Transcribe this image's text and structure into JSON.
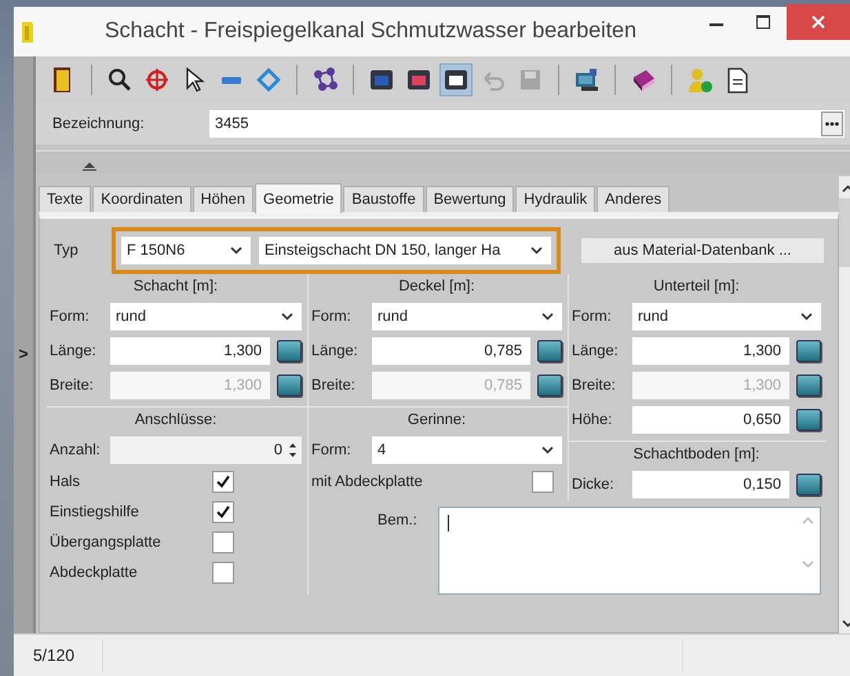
{
  "window": {
    "title": "Schacht - Freispiegelkanal Schmutzwasser bearbeiten"
  },
  "toolbar": {
    "groups": [
      [
        {
          "kind": "door",
          "selected": false,
          "disabled": false
        }
      ],
      [
        {
          "kind": "search",
          "selected": false,
          "disabled": false
        },
        {
          "kind": "crosshair",
          "selected": false,
          "disabled": false
        },
        {
          "kind": "pointer",
          "selected": false,
          "disabled": false
        },
        {
          "kind": "minus",
          "selected": false,
          "disabled": false
        },
        {
          "kind": "diamond",
          "selected": false,
          "disabled": false
        }
      ],
      [
        {
          "kind": "network",
          "selected": false,
          "disabled": false
        }
      ],
      [
        {
          "kind": "window-blue",
          "selected": false,
          "disabled": false
        },
        {
          "kind": "window-red",
          "selected": false,
          "disabled": false
        },
        {
          "kind": "window-white",
          "selected": true,
          "disabled": false
        },
        {
          "kind": "undo",
          "selected": false,
          "disabled": true
        },
        {
          "kind": "save",
          "selected": false,
          "disabled": true
        }
      ],
      [
        {
          "kind": "monitor",
          "selected": false,
          "disabled": false
        }
      ],
      [
        {
          "kind": "book",
          "selected": false,
          "disabled": false
        }
      ],
      [
        {
          "kind": "user",
          "selected": false,
          "disabled": false
        },
        {
          "kind": "document",
          "selected": false,
          "disabled": false
        }
      ]
    ]
  },
  "bezeichnung": {
    "label": "Bezeichnung:",
    "value": "3455"
  },
  "splitter_arrow": ">",
  "tabs": [
    {
      "label": "Texte",
      "selected": false
    },
    {
      "label": "Koordinaten",
      "selected": false
    },
    {
      "label": "Höhen",
      "selected": false
    },
    {
      "label": "Geometrie",
      "selected": true
    },
    {
      "label": "Baustoffe",
      "selected": false
    },
    {
      "label": "Bewertung",
      "selected": false
    },
    {
      "label": "Hydraulik",
      "selected": false
    },
    {
      "label": "Anderes",
      "selected": false
    }
  ],
  "typ": {
    "label": "Typ",
    "code": "F 150N6",
    "description": "Einsteigschacht DN 150, langer Ha",
    "highlighted": true,
    "button": "aus Material-Datenbank ..."
  },
  "schacht": {
    "heading": "Schacht [m]:",
    "rows": [
      {
        "kind": "select",
        "label": "Form:",
        "value": "rund"
      },
      {
        "kind": "number",
        "label": "Länge:",
        "value": "1,300",
        "disabled": false
      },
      {
        "kind": "number",
        "label": "Breite:",
        "value": "1,300",
        "disabled": true
      }
    ]
  },
  "deckel": {
    "heading": "Deckel [m]:",
    "rows": [
      {
        "kind": "select",
        "label": "Form:",
        "value": "rund"
      },
      {
        "kind": "number",
        "label": "Länge:",
        "value": "0,785",
        "disabled": false
      },
      {
        "kind": "number",
        "label": "Breite:",
        "value": "0,785",
        "disabled": true
      }
    ]
  },
  "unterteil": {
    "heading": "Unterteil [m]:",
    "rows": [
      {
        "kind": "select",
        "label": "Form:",
        "value": "rund"
      },
      {
        "kind": "number",
        "label": "Länge:",
        "value": "1,300",
        "disabled": false
      },
      {
        "kind": "number",
        "label": "Breite:",
        "value": "1,300",
        "disabled": true
      },
      {
        "kind": "number",
        "label": "Höhe:",
        "value": "0,650",
        "disabled": false
      }
    ]
  },
  "schachtboden": {
    "heading": "Schachtboden [m]:",
    "rows": [
      {
        "kind": "number",
        "label": "Dicke:",
        "value": "0,150",
        "disabled": false
      }
    ]
  },
  "anschluesse": {
    "heading": "Anschlüsse:",
    "anzahl": {
      "label": "Anzahl:",
      "value": "0"
    },
    "checkboxes": [
      {
        "label": "Hals",
        "checked": true
      },
      {
        "label": "Einstiegshilfe",
        "checked": true
      },
      {
        "label": "Übergangsplatte",
        "checked": false
      },
      {
        "label": "Abdeckplatte",
        "checked": false
      }
    ]
  },
  "gerinne": {
    "heading": "Gerinne:",
    "form": {
      "label": "Form:",
      "value": "4"
    },
    "abdeckplatte": {
      "label": "mit Abdeckplatte",
      "checked": false
    }
  },
  "bemerkung": {
    "label": "Bem.:"
  },
  "status_bar": [
    "5/120"
  ]
}
